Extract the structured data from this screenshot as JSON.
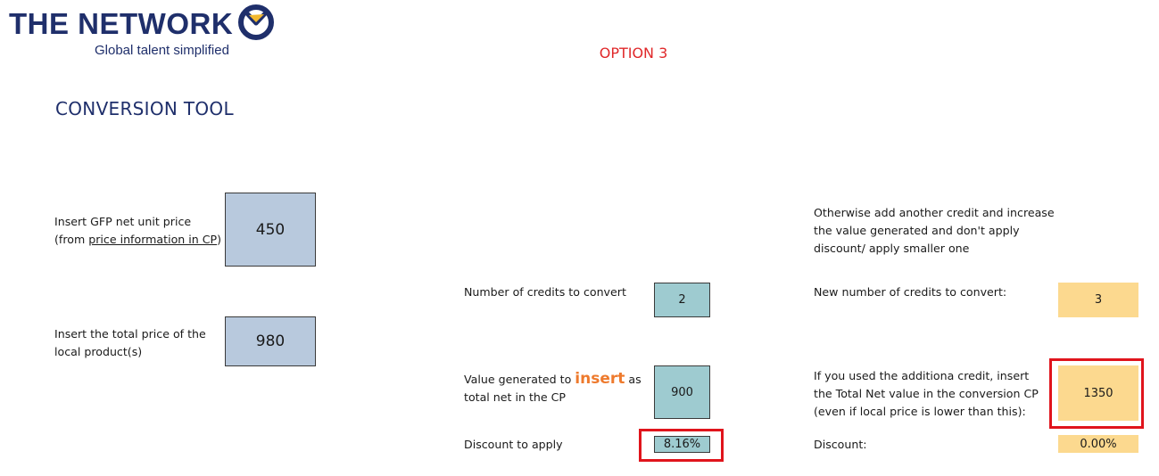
{
  "logo": {
    "title": "THE NETWORK",
    "subtitle": "Global talent simplified",
    "colors": {
      "navy": "#1f2f6b",
      "gold": "#f2b82e"
    },
    "mark_icon": "network-circle-logo-icon"
  },
  "option_title": "OPTION 3",
  "section_title": "CONVERSION TOOL",
  "inputs": {
    "gfp_label_prefix": "Insert GFP net unit price (from ",
    "gfp_label_link": "price information in CP",
    "gfp_label_suffix": ")",
    "gfp_value": "450",
    "local_label": "Insert the total price of the local product(s)",
    "local_value": "980"
  },
  "middle": {
    "credits_label": "Number of credits to convert",
    "credits_value": "2",
    "value_label_prefix": "Value generated to ",
    "value_label_emph": "insert",
    "value_label_suffix": " as total net in the CP",
    "value_value": "900",
    "discount_label": "Discount to apply",
    "discount_value": "8.16%"
  },
  "right": {
    "intro_text": "Otherwise add another credit and increase the value generated and don't apply discount/ apply smaller one",
    "new_credits_label": "New number of credits to convert:",
    "new_credits_value": "3",
    "total_net_label": "If you used the additiona credit, insert the Total Net value in the conversion CP (even if local price is lower than this):",
    "total_net_value": "1350",
    "discount_label": "Discount:",
    "discount_value": "0.00%"
  },
  "colors": {
    "input_blue": "#b8c9dd",
    "output_teal": "#9ecbd0",
    "alt_orange": "#fcd98f",
    "highlight_red": "#e0141c",
    "title_red": "#e0282a",
    "insert_orange": "#ee7a2d"
  }
}
